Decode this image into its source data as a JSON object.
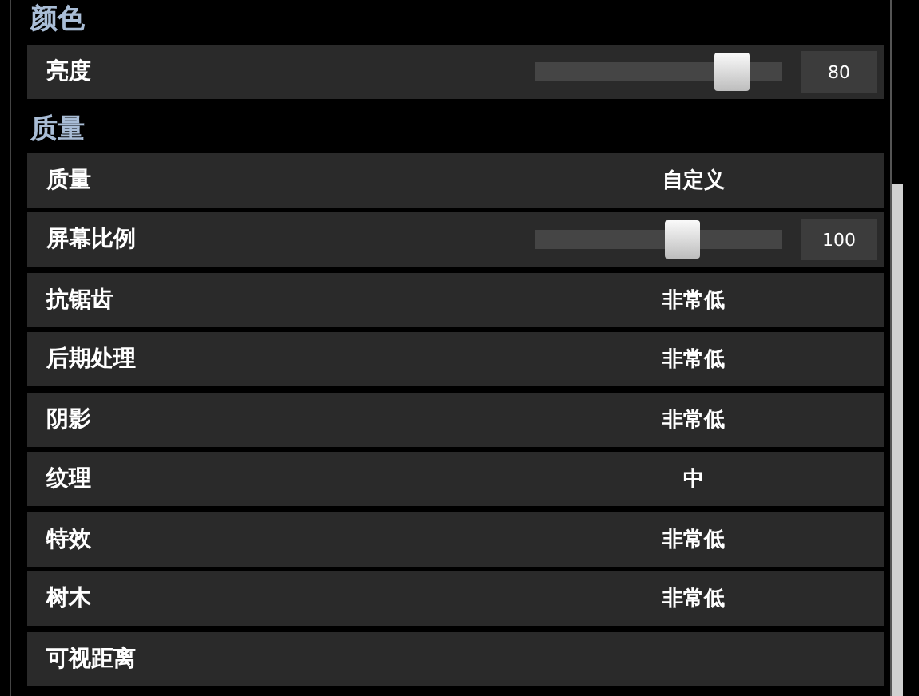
{
  "sections": [
    {
      "title": "颜色",
      "settings": [
        {
          "kind": "slider",
          "label": "亮度",
          "level": 0.8,
          "reading": "80"
        }
      ]
    },
    {
      "title": "质量",
      "settings": [
        {
          "kind": "select",
          "label": "质量",
          "value": "自定义"
        },
        {
          "kind": "slider",
          "label": "屏幕比例",
          "level": 0.6,
          "reading": "100"
        },
        {
          "kind": "select",
          "label": "抗锯齿",
          "value": "非常低"
        },
        {
          "kind": "select",
          "label": "后期处理",
          "value": "非常低"
        },
        {
          "kind": "select",
          "label": "阴影",
          "value": "非常低"
        },
        {
          "kind": "select",
          "label": "纹理",
          "value": "中"
        },
        {
          "kind": "select",
          "label": "特效",
          "value": "非常低"
        },
        {
          "kind": "select",
          "label": "树木",
          "value": "非常低"
        },
        {
          "kind": "label",
          "label": "可视距离"
        }
      ]
    }
  ]
}
